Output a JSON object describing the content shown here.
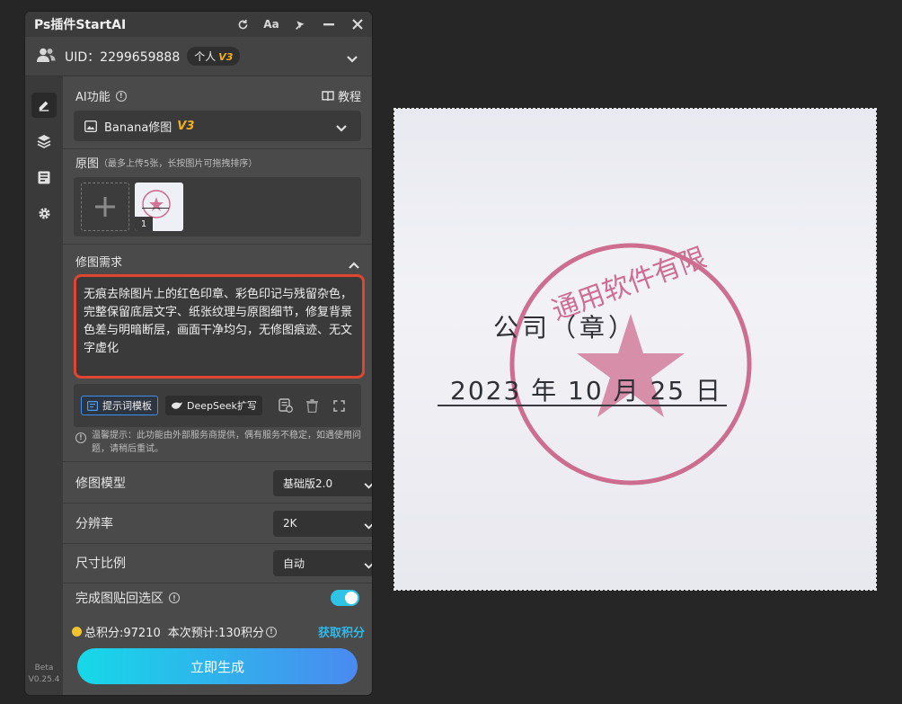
{
  "panel": {
    "title": "Ps插件StartAI",
    "title_buttons": [
      "refresh-icon",
      "font-size-icon",
      "pin-icon",
      "minimize-icon",
      "close-icon"
    ]
  },
  "user": {
    "uid": "UID：2299659888",
    "plan": "个人",
    "plan_version": "V3"
  },
  "sidebar": {
    "items": [
      "edit-icon",
      "layers-icon",
      "save-icon",
      "settings-icon"
    ],
    "version_line1": "Beta",
    "version_line2": "V0.25.4"
  },
  "ai_function": {
    "label": "AI功能",
    "tutorial": "教程",
    "selected": "Banana修图",
    "selected_version": "V3"
  },
  "source": {
    "label": "原图",
    "hint": "（最多上传5张，长按图片可拖拽排序）",
    "thumb_index": "1"
  },
  "requirement": {
    "label": "修图需求",
    "text": "无痕去除图片上的红色印章、彩色印记与残留杂色，完整保留底层文字、纸张纹理与原图细节，修复背景色差与明暗断层，画面干净均匀，无修图痕迹、无文字虚化",
    "template_btn": "提示词模板",
    "deepseek_btn": "DeepSeek扩写",
    "notice": "温馨提示：此功能由外部服务商提供，偶有服务不稳定，如遇使用问题，请稍后重试。"
  },
  "settings": {
    "model_label": "修图模型",
    "model_value": "基础版2.0",
    "resolution_label": "分辨率",
    "resolution_value": "2K",
    "ratio_label": "尺寸比例",
    "ratio_value": "自动",
    "paste_label": "完成图贴回选区",
    "paste_on": true
  },
  "footer": {
    "total_points": "总积分:97210",
    "estimate": "本次预计:130积分",
    "get_points": "获取积分",
    "generate": "立即生成"
  },
  "canvas": {
    "line1": "公司（章）",
    "line2": "2023 年 10 月 25 日",
    "stamp_text": "通用软件有限",
    "stamp_color": "#c2426e"
  },
  "colors": {
    "accent": "#2fc3e6",
    "highlight": "#e0462f",
    "vip": "#f2b01e",
    "link": "#30b8e8"
  }
}
